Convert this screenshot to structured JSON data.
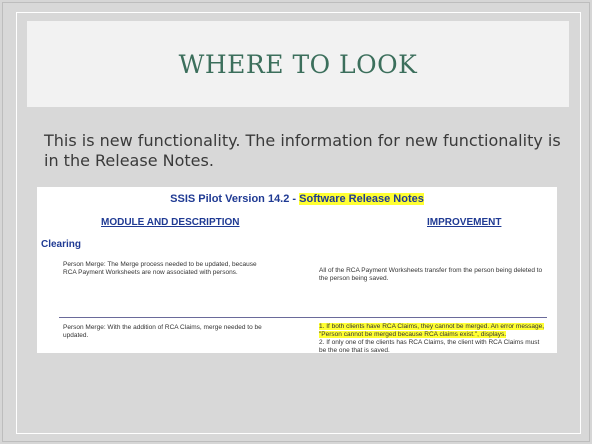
{
  "slide": {
    "title": "WHERE TO LOOK",
    "body": "This is new functionality.  The information for new functionality is in the Release Notes."
  },
  "release_notes": {
    "title_prefix": "SSIS Pilot Version 14.2 - ",
    "title_highlight": "Software Release Notes",
    "col_module": "MODULE AND DESCRIPTION",
    "col_improvement": "IMPROVEMENT",
    "section": "Clearing",
    "rows": [
      {
        "module": "Person Merge: The Merge process needed to be updated, because RCA Payment Worksheets are now associated with persons.",
        "improvement": "All of the RCA Payment Worksheets transfer from the person being deleted to the person being saved."
      },
      {
        "module": "Person Merge:  With the addition of RCA Claims, merge needed to be updated.",
        "improvement_1": "1.  If both clients have RCA Claims, they cannot be merged. An error message, \"Person cannot be merged because RCA claims exist.\", displays.",
        "improvement_2": "2.  If only one of the clients has RCA Claims, the client with RCA Claims must be the one that is saved."
      }
    ]
  },
  "colors": {
    "title": "#3c6f5c",
    "accent_blue": "#1f3a93",
    "highlight": "#ffff33"
  }
}
